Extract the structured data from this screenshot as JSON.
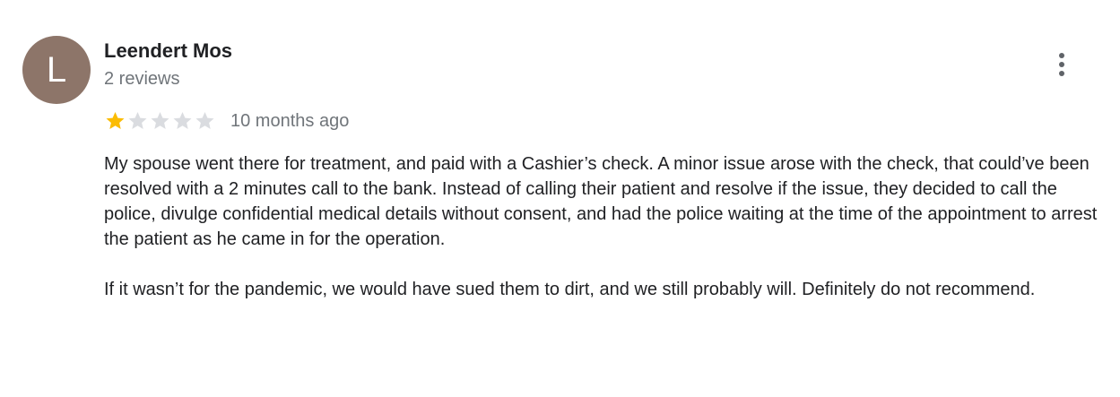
{
  "review": {
    "avatar_letter": "L",
    "author_name": "Leendert Mos",
    "review_count": "2 reviews",
    "rating": 1,
    "max_rating": 5,
    "time_ago": "10 months ago",
    "paragraphs": [
      "My spouse went there for treatment, and paid with a Cashier’s check. A minor issue arose with the check, that could’ve been resolved with a 2 minutes call to the bank. Instead of calling their patient and resolve if the issue, they decided to call the police, divulge confidential medical details without consent, and had the police waiting at the time of the appointment to arrest the patient as he came in for the operation.",
      "If it wasn’t for the pandemic, we would have sued them to dirt, and we still probably will. Definitely do not recommend."
    ]
  },
  "colors": {
    "avatar_bg": "#8d7569",
    "star_filled": "#fbbc04",
    "star_empty": "#dadce0",
    "secondary_text": "#70757a",
    "primary_text": "#202124"
  },
  "icons": {
    "menu": "more-vert-icon",
    "star": "star-icon"
  }
}
